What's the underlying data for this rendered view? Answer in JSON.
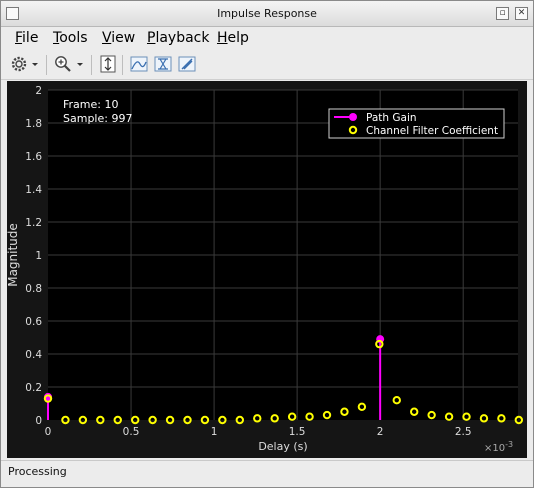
{
  "window": {
    "title": "Impulse Response"
  },
  "menu": [
    {
      "label": "File",
      "mnemonic": "F",
      "rest": "ile"
    },
    {
      "label": "Tools",
      "mnemonic": "T",
      "rest": "ools"
    },
    {
      "label": "View",
      "mnemonic": "V",
      "rest": "iew"
    },
    {
      "label": "Playback",
      "mnemonic": "P",
      "rest": "layback"
    },
    {
      "label": "Help",
      "mnemonic": "H",
      "rest": "elp"
    }
  ],
  "toolbar": {
    "icons": [
      "settings-gear-icon",
      "dropdown-arrow-icon",
      "zoom-in-icon",
      "dropdown-arrow-icon",
      "scale-axes-icon",
      "data-cursors-icon",
      "peak-finder-icon",
      "measure-icon"
    ]
  },
  "plot": {
    "info_frame": "Frame: 10",
    "info_sample": "Sample: 997",
    "exponent_label": "×10",
    "exponent_power": "-3"
  },
  "status": {
    "text": "Processing"
  },
  "colors": {
    "plot_background": "#000000",
    "frame_background": "#151515",
    "grid": "#3a3a3a",
    "path_gain": "#ff00ff",
    "filter_coeff": "#ffff00",
    "text": "#dddddd"
  },
  "chart_data": {
    "type": "scatter",
    "xlabel": "Delay (s)",
    "ylabel": "Magnitude",
    "xlim": [
      0,
      0.00283
    ],
    "ylim": [
      0,
      2
    ],
    "x_scale_note": "x10^-3",
    "xticks": [
      "0",
      "0.5",
      "1",
      "1.5",
      "2",
      "2.5"
    ],
    "xtick_values": [
      0,
      0.0005,
      0.001,
      0.0015,
      0.002,
      0.0025
    ],
    "yticks": [
      "0",
      "0.2",
      "0.4",
      "0.6",
      "0.8",
      "1",
      "1.2",
      "1.4",
      "1.6",
      "1.8",
      "2"
    ],
    "ytick_values": [
      0,
      0.2,
      0.4,
      0.6,
      0.8,
      1.0,
      1.2,
      1.4,
      1.6,
      1.8,
      2.0
    ],
    "grid": true,
    "legend_position": "top-right",
    "series": [
      {
        "name": "Path Gain",
        "style": "stem",
        "color": "#ff00ff",
        "x": [
          0,
          0.002
        ],
        "y": [
          0.14,
          0.49
        ]
      },
      {
        "name": "Channel Filter Coefficient",
        "style": "circle",
        "color": "#ffff00",
        "x": [
          0,
          0.000105,
          0.00021,
          0.000315,
          0.00042,
          0.000525,
          0.00063,
          0.000735,
          0.00084,
          0.000945,
          0.00105,
          0.001155,
          0.00126,
          0.001365,
          0.00147,
          0.001575,
          0.00168,
          0.001785,
          0.00189,
          0.001995,
          0.0021,
          0.002205,
          0.00231,
          0.002415,
          0.00252,
          0.002625,
          0.00273,
          0.002835
        ],
        "y": [
          0.13,
          0.0,
          0.0,
          0.0,
          0.0,
          0.0,
          0.0,
          0.0,
          0.0,
          0.0,
          0.0,
          0.0,
          0.01,
          0.01,
          0.02,
          0.02,
          0.03,
          0.05,
          0.08,
          0.46,
          0.12,
          0.05,
          0.03,
          0.02,
          0.02,
          0.01,
          0.01,
          0.0
        ]
      }
    ]
  }
}
